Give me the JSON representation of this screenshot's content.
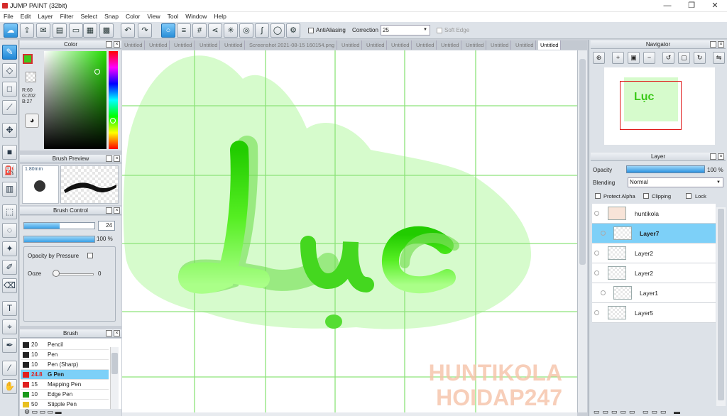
{
  "title": "JUMP PAINT (32bit)",
  "window_controls": [
    "—",
    "❐",
    "✕"
  ],
  "menu": [
    "File",
    "Edit",
    "Layer",
    "Filter",
    "Select",
    "Snap",
    "Color",
    "View",
    "Tool",
    "Window",
    "Help"
  ],
  "toolbar": {
    "antialiasing": "AntiAliasing",
    "correction_label": "Correction",
    "correction_value": "25",
    "soft_edge": "Soft Edge"
  },
  "color_panel": {
    "title": "Color",
    "r": "R:60",
    "g": "G:202",
    "b": "B:27",
    "fg": "#3cca1b"
  },
  "brush_preview": {
    "title": "Brush Preview",
    "size": "1.80mm"
  },
  "brush_control": {
    "title": "Brush Control",
    "size": "24",
    "opacity": "100 %",
    "opacity_pressure": "Opacity by Pressure",
    "ooze": "Ooze",
    "ooze_value": "0"
  },
  "brush": {
    "title": "Brush",
    "items": [
      {
        "size": "20",
        "name": "Pencil",
        "color": "#222222"
      },
      {
        "size": "10",
        "name": "Pen",
        "color": "#222222"
      },
      {
        "size": "10",
        "name": "Pen (Sharp)",
        "color": "#222222"
      },
      {
        "size": "24.8",
        "name": "G Pen",
        "color": "#e02020",
        "selected": true
      },
      {
        "size": "15",
        "name": "Mapping Pen",
        "color": "#e02020"
      },
      {
        "size": "10",
        "name": "Edge Pen",
        "color": "#1a9a1a"
      },
      {
        "size": "50",
        "name": "Stipple Pen",
        "color": "#e8c020"
      }
    ]
  },
  "tabs": [
    "Untitled",
    "Untitled",
    "Untitled",
    "Untitled",
    "Untitled",
    "Screenshot 2021-08-15 160154.png",
    "Untitled",
    "Untitled",
    "Untitled",
    "Untitled",
    "Untitled",
    "Untitled",
    "Untitled",
    "Untitled",
    "Untitled",
    "Untitled",
    "Untitled"
  ],
  "canvas": {
    "text": "Lục",
    "watermark1": "HUNTIKOLA",
    "watermark2": "HOIDAP247"
  },
  "navigator": {
    "title": "Navigator"
  },
  "layer_panel": {
    "title": "Layer",
    "opacity_label": "Opacity",
    "opacity_value": "100 %",
    "blending_label": "Blending",
    "blending_value": "Normal",
    "protect_alpha": "Protect Alpha",
    "clipping": "Clipping",
    "lock": "Lock",
    "layers": [
      {
        "name": "huntikola"
      },
      {
        "name": "Layer7",
        "selected": true
      },
      {
        "name": "Layer2"
      },
      {
        "name": "Layer2"
      },
      {
        "name": "Layer1"
      },
      {
        "name": "Layer5"
      }
    ]
  }
}
